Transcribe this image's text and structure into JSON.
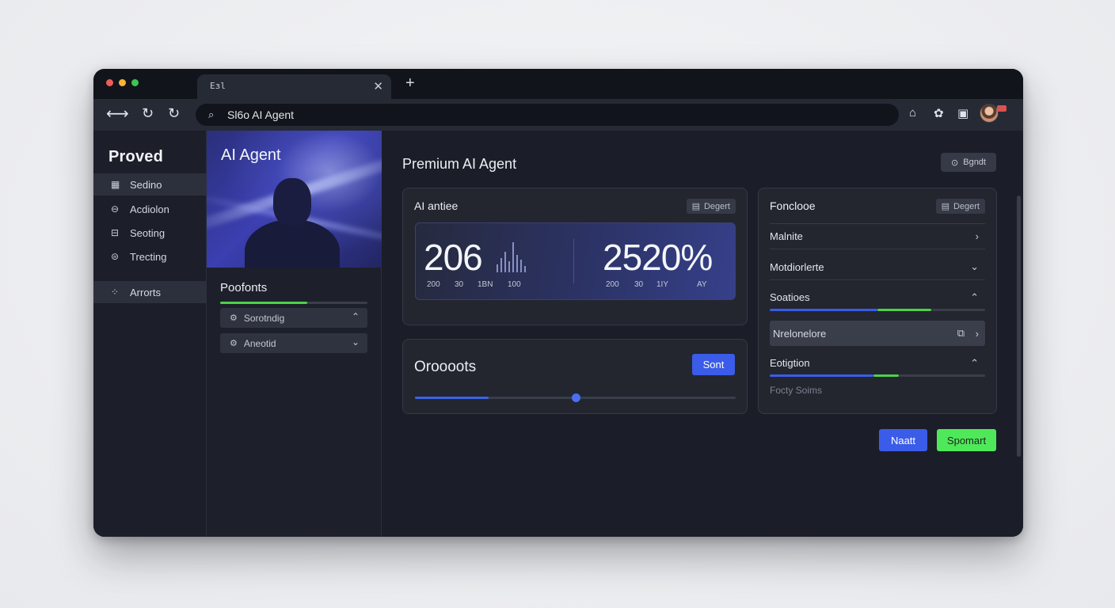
{
  "browser": {
    "tab_icon": "Eзl",
    "url": "Sl6o AI Agent",
    "colors": {
      "close": "#ee5d56",
      "minimize": "#f2b534",
      "maximize": "#3ec451"
    }
  },
  "sidebar": {
    "brand": "Proved",
    "items": [
      {
        "label": "Sedino",
        "icon": "grid-icon"
      },
      {
        "label": "Acdiolon",
        "icon": "compass-icon"
      },
      {
        "label": "Seoting",
        "icon": "table-icon"
      },
      {
        "label": "Trecting",
        "icon": "circle-icon"
      },
      {
        "label": "Arrorts",
        "icon": "apps-icon"
      }
    ]
  },
  "hero": {
    "title": "AI Agent",
    "panel_label": "Poofonts",
    "progress": 0.59,
    "dropdowns": [
      {
        "label": "Sorotndig",
        "chevron": "up"
      },
      {
        "label": "Aneotid",
        "chevron": "down"
      }
    ]
  },
  "main": {
    "title": "Premium AI Agent",
    "top_action": "Bgndt",
    "stats_card": {
      "title": "AI antiee",
      "chip": "Degert",
      "left_value": "206",
      "left_labels": [
        "200",
        "30",
        "1BN",
        "100"
      ],
      "right_value": "2520%",
      "right_labels": [
        "200",
        "30",
        "1IY",
        "AY"
      ]
    },
    "slider_card": {
      "title": "Oroooots",
      "button": "Sont",
      "fill": 0.23,
      "thumb": 0.5
    },
    "right_card": {
      "title": "Fonclooe",
      "chip": "Degert",
      "rows": [
        {
          "label": "Malnite",
          "chevron": "›"
        },
        {
          "label": "Motdiorlerte",
          "chevron": "⌄"
        },
        {
          "label": "Soatioes",
          "chevron": "⌃"
        },
        {
          "label": "Nrelonelore",
          "chevron": "›"
        },
        {
          "label": "Eotigtion",
          "chevron": "⌃"
        }
      ],
      "footer": "Focty Soims",
      "bar1": {
        "blue": 0.5,
        "green": 0.75
      },
      "bar2": {
        "blue": 0.48,
        "green": 0.6
      }
    },
    "buttons": {
      "primary": "Naatt",
      "secondary": "Spomart"
    }
  }
}
